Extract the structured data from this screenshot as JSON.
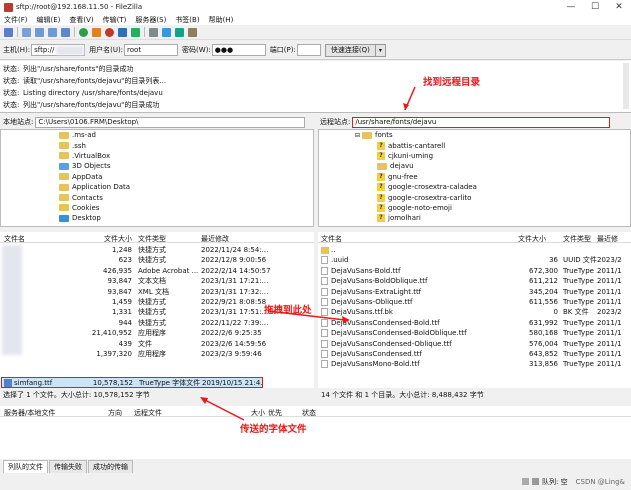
{
  "window": {
    "title": "sftp://root@192.168.11.50 - FileZilla",
    "minimize": "—",
    "maximize": "☐",
    "close": "✕"
  },
  "menu": [
    "文件(F)",
    "编辑(E)",
    "查看(V)",
    "传输(T)",
    "服务器(S)",
    "书签(B)",
    "帮助(H)"
  ],
  "quickconnect": {
    "host_label": "主机(H):",
    "host_value": "sftp://",
    "user_label": "用户名(U):",
    "user_value": "root",
    "pass_label": "密码(W):",
    "pass_value": "●●●",
    "port_label": "端口(P):",
    "port_value": "",
    "button": "快速连接(Q)",
    "dropdown": "▾"
  },
  "log": [
    {
      "tag": "状态:",
      "text": "列出\"/usr/share/fonts\"的目录成功"
    },
    {
      "tag": "状态:",
      "text": "读取\"/usr/share/fonts/dejavu\"的目录列表..."
    },
    {
      "tag": "状态:",
      "text": "Listing directory /usr/share/fonts/dejavu"
    },
    {
      "tag": "状态:",
      "text": "列出\"/usr/share/fonts/dejavu\"的目录成功"
    }
  ],
  "local": {
    "site_label": "本地站点:",
    "path": "C:\\Users\\0106.FRM\\Desktop\\",
    "tree": [
      ".ms-ad",
      ".ssh",
      ".VirtualBox",
      "3D Objects",
      "AppData",
      "Application Data",
      "Contacts",
      "Cookies",
      "Desktop"
    ],
    "headers": [
      "文件名",
      "文件大小",
      "文件类型",
      "最近修改"
    ],
    "files": [
      {
        "size": "1,248",
        "type": "快捷方式",
        "date": "2022/11/24 8:54:..."
      },
      {
        "size": "623",
        "type": "快捷方式",
        "date": "2022/12/8 9:00:56"
      },
      {
        "size": "426,935",
        "type": "Adobe Acrobat ...",
        "date": "2022/2/14 14:50:57"
      },
      {
        "size": "93,847",
        "type": "文本文档",
        "date": "2023/1/31 17:21:..."
      },
      {
        "size": "93,847",
        "type": "XML 文档",
        "date": "2023/1/31 17:32:..."
      },
      {
        "size": "1,459",
        "type": "快捷方式",
        "date": "2022/9/21 8:08:58"
      },
      {
        "size": "1,331",
        "type": "快捷方式",
        "date": "2023/1/31 17:51:..."
      },
      {
        "size": "944",
        "type": "快捷方式",
        "date": "2022/11/22 7:39:..."
      },
      {
        "size": "21,410,952",
        "type": "应用程序",
        "date": "2022/2/6 9:25:35"
      },
      {
        "size": "439",
        "type": "文件",
        "date": "2023/2/6 14:59:56"
      },
      {
        "size": "1,397,320",
        "type": "应用程序",
        "date": "2023/2/3 9:59:46"
      },
      {
        "size": "",
        "type": "",
        "date": ""
      },
      {
        "name": "simfang.ttf",
        "size": "10,578,152",
        "type": "TrueType 字体文件",
        "date": "2019/10/15 21:4..."
      }
    ],
    "status": "选择了 1 个文件。大小总计: 10,578,152 字节"
  },
  "remote": {
    "site_label": "远程站点:",
    "path": "/usr/share/fonts/dejavu",
    "tree": [
      "fonts",
      "abattis-cantarell",
      "cjkuni-uming",
      "dejavu",
      "gnu-free",
      "google-crosextra-caladea",
      "google-crosextra-carlito",
      "google-noto-emoji",
      "jomolhari"
    ],
    "headers": [
      "文件名",
      "文件大小",
      "文件类型",
      "最近修"
    ],
    "files": [
      {
        "name": "..",
        "size": "",
        "type": "",
        "date": ""
      },
      {
        "name": ".uuid",
        "size": "36",
        "type": "UUID 文件",
        "date": "2023/2"
      },
      {
        "name": "DejaVuSans-Bold.ttf",
        "size": "672,300",
        "type": "TrueType ...",
        "date": "2011/1"
      },
      {
        "name": "DejaVuSans-BoldOblique.ttf",
        "size": "611,212",
        "type": "TrueType ...",
        "date": "2011/1"
      },
      {
        "name": "DejaVuSans-ExtraLight.ttf",
        "size": "345,204",
        "type": "TrueType ...",
        "date": "2011/1"
      },
      {
        "name": "DejaVuSans-Oblique.ttf",
        "size": "611,556",
        "type": "TrueType ...",
        "date": "2011/1"
      },
      {
        "name": "DejaVuSans.ttf.bk",
        "size": "0",
        "type": "BK 文件",
        "date": "2023/2"
      },
      {
        "name": "DejaVuSansCondensed-Bold.ttf",
        "size": "631,992",
        "type": "TrueType ...",
        "date": "2011/1"
      },
      {
        "name": "DejaVuSansCondensed-BoldOblique.ttf",
        "size": "580,168",
        "type": "TrueType ...",
        "date": "2011/1"
      },
      {
        "name": "DejaVuSansCondensed-Oblique.ttf",
        "size": "576,004",
        "type": "TrueType ...",
        "date": "2011/1"
      },
      {
        "name": "DejaVuSansCondensed.ttf",
        "size": "643,852",
        "type": "TrueType ...",
        "date": "2011/1"
      },
      {
        "name": "DejaVuSansMono-Bold.ttf",
        "size": "313,856",
        "type": "TrueType ...",
        "date": "2011/1"
      }
    ],
    "status": "14 个文件 和 1 个目录。大小总计: 8,488,432 字节"
  },
  "queue": {
    "headers": [
      "服务器/本地文件",
      "方向",
      "远程文件",
      "大小",
      "优先",
      "状态"
    ]
  },
  "tabs": [
    "列队的文件",
    "传输失败",
    "成功的传输"
  ],
  "bottom": {
    "queue_label": "队列: 空",
    "watermark": "CSDN @Ling&"
  },
  "annotations": {
    "remote_dir": "找到远程目录",
    "drag": "拖拽到此处",
    "font_file": "传送的字体文件"
  }
}
